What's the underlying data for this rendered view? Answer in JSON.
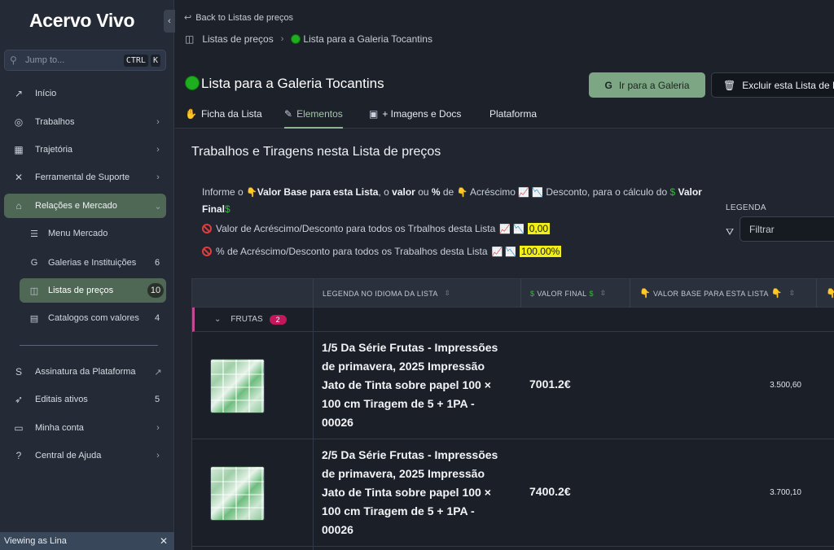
{
  "sidebar": {
    "brand": "Acervo Vivo",
    "collapse_glyph": "‹",
    "jump_placeholder": "Jump to...",
    "shortcut_keys": [
      "CTRL",
      "K"
    ],
    "items": [
      {
        "label": "Início",
        "icon": "arrow-up-right-icon"
      },
      {
        "label": "Trabalhos",
        "icon": "target-icon",
        "chevron": "›"
      },
      {
        "label": "Trajetória",
        "icon": "calendar-icon",
        "chevron": "›"
      },
      {
        "label": "Ferramental de Suporte",
        "icon": "tools-icon",
        "chevron": "›"
      },
      {
        "label": "Relações e Mercado",
        "icon": "store-icon",
        "chevron": "⌄"
      }
    ],
    "sub_items": [
      {
        "label": "Menu Mercado",
        "icon": "menu-icon"
      },
      {
        "label": "Galerias e Instituições",
        "count": "6",
        "icon": "g-logo-icon"
      },
      {
        "label": "Listas de preços",
        "count": "10",
        "icon": "shopping-bag-icon"
      },
      {
        "label": "Catalogos com valores",
        "count": "4",
        "icon": "book-icon"
      }
    ],
    "bottom_items": [
      {
        "label": "Assinatura da Plataforma",
        "icon": "s-logo-icon",
        "chevron": "↗"
      },
      {
        "label": "Editais ativos",
        "count": "5",
        "icon": "rocket-icon"
      },
      {
        "label": "Minha conta",
        "icon": "folder-icon",
        "chevron": "›"
      },
      {
        "label": "Central de Ajuda",
        "icon": "help-icon",
        "chevron": "›"
      }
    ],
    "viewing_as": "Viewing as Lina",
    "viewing_close": "✕"
  },
  "header": {
    "back_label": "Back to Listas de preços",
    "breadcrumb_root": "Listas de preços",
    "breadcrumb_sep": "›",
    "breadcrumb_current": "Lista para a Galeria Tocantins",
    "page_title": "Lista para a Galeria Tocantins",
    "btn_galeria": "Ir para a Galeria",
    "btn_excluir": "Excluir esta Lista de Preços"
  },
  "tabs": [
    {
      "label": "Ficha da Lista",
      "icon": "hand-icon"
    },
    {
      "label": "Elementos",
      "icon": "broom-icon",
      "active": true
    },
    {
      "label": "+ Imagens e Docs",
      "icon": "image-icon"
    },
    {
      "label": "Plataforma"
    }
  ],
  "content": {
    "section_title": "Trabalhos e Tiragens nesta Lista de preços",
    "info_p1": "Informe o ",
    "info_b1": "Valor Base para esta Lista",
    "info_p2": ", o ",
    "info_b2": "valor",
    "info_p3": " ou ",
    "info_b3": "%",
    "info_p4": " de ",
    "info_p5": " Acréscimo ",
    "info_p6": " Desconto, para o cálculo do ",
    "info_b4": "Valor Final",
    "row1_label": "Valor de Acréscimo/Desconto para todos os Trbalhos desta Lista",
    "row1_value": "0,00",
    "row2_label": "% de Acréscimo/Desconto para todos os Trabalhos desta Lista",
    "row2_value": "100.00%",
    "legenda_label": "LEGENDA",
    "filter_placeholder": "Filtrar"
  },
  "table": {
    "columns": [
      "",
      "LEGENDA NO IDIOMA DA LISTA",
      "VALOR FINAL",
      "VALOR BASE PARA ESTA LISTA"
    ],
    "group": {
      "label": "FRUTAS",
      "count": "2"
    },
    "rows": [
      {
        "title": "1/5 Da Série Frutas - Impressões de primavera, 2025 Impressão Jato de Tinta sobre papel 100 × 100 cm Tiragem de 5 + 1PA - 00026",
        "valor_final": "7001.2€",
        "valor_base": "3.500,60"
      },
      {
        "title": "2/5 Da Série Frutas - Impressões de primavera, 2025 Impressão Jato de Tinta sobre papel 100 × 100 cm Tiragem de 5 + 1PA - 00026",
        "valor_final": "7400.2€",
        "valor_base": "3.700,10"
      }
    ]
  }
}
